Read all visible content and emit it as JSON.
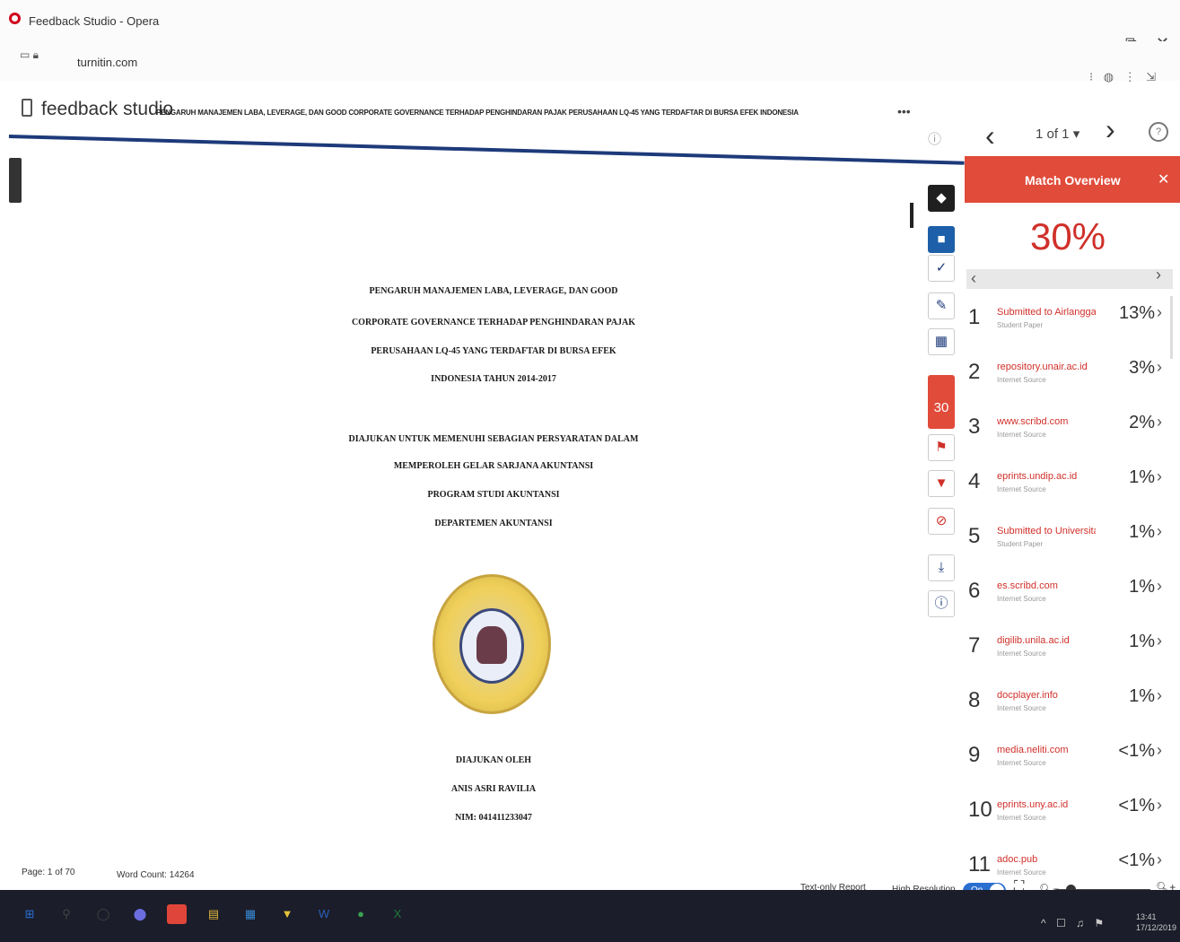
{
  "window": {
    "title": "Feedback Studio - Opera",
    "url": "turnitin.com",
    "minimize": "–",
    "restore": "⧉",
    "close": "✕",
    "toolbar_glyphs": "⁝ ◍ ⋮ ⇲"
  },
  "header": {
    "brand": "feedback studio",
    "document_title": "PENGARUH MANAJEMEN LABA, LEVERAGE, DAN GOOD CORPORATE GOVERNANCE TERHADAP PENGHINDARAN PAJAK PERUSAHAAN LQ-45 YANG TERDAFTAR DI BURSA EFEK INDONESIA",
    "more": "•••",
    "info": "ⓘ",
    "page_selector": "1 of 1 ▾",
    "prev": "‹",
    "next": "›",
    "help": "?"
  },
  "document": {
    "title_lines": [
      "PENGARUH MANAJEMEN LABA, LEVERAGE, DAN GOOD",
      "CORPORATE GOVERNANCE TERHADAP PENGHINDARAN PAJAK",
      "PERUSAHAAN LQ-45 YANG TERDAFTAR DI BURSA EFEK",
      "INDONESIA TAHUN 2014-2017"
    ],
    "purpose_lines": [
      "DIAJUKAN UNTUK MEMENUHI SEBAGIAN PERSYARATAN DALAM",
      "MEMPEROLEH GELAR SARJANA AKUNTANSI",
      "PROGRAM STUDI AKUNTANSI",
      "DEPARTEMEN AKUNTANSI"
    ],
    "author_lines": [
      "DIAJUKAN OLEH",
      "ANIS ASRI RAVILIA",
      "NIM: 041411233047"
    ]
  },
  "toolbar": {
    "layer_icon": "◆",
    "layer2_icon": "■",
    "check_icon": "✓",
    "edit_icon": "✎",
    "grid_icon": "▦",
    "score_badge": "30",
    "flag_icon": "⚑",
    "filter_icon": "▼",
    "exclude_icon": "⊘",
    "download_icon": "⤓",
    "info_icon": "ⓘ"
  },
  "match_overview": {
    "title": "Match Overview",
    "close": "✕",
    "score": "30%",
    "prev": "‹",
    "next": "›",
    "matches": [
      {
        "num": "1",
        "source": "Submitted to Airlangga",
        "type": "Student Paper",
        "pct": "13%"
      },
      {
        "num": "2",
        "source": "repository.unair.ac.id",
        "type": "Internet Source",
        "pct": "3%"
      },
      {
        "num": "3",
        "source": "www.scribd.com",
        "type": "Internet Source",
        "pct": "2%"
      },
      {
        "num": "4",
        "source": "eprints.undip.ac.id",
        "type": "Internet Source",
        "pct": "1%"
      },
      {
        "num": "5",
        "source": "Submitted to Universitas...",
        "type": "Student Paper",
        "pct": "1%"
      },
      {
        "num": "6",
        "source": "es.scribd.com",
        "type": "Internet Source",
        "pct": "1%"
      },
      {
        "num": "7",
        "source": "digilib.unila.ac.id",
        "type": "Internet Source",
        "pct": "1%"
      },
      {
        "num": "8",
        "source": "docplayer.info",
        "type": "Internet Source",
        "pct": "1%"
      },
      {
        "num": "9",
        "source": "media.neliti.com",
        "type": "Internet Source",
        "pct": "<1%"
      },
      {
        "num": "10",
        "source": "eprints.uny.ac.id",
        "type": "Internet Source",
        "pct": "<1%"
      },
      {
        "num": "11",
        "source": "adoc.pub",
        "type": "Internet Source",
        "pct": "<1%"
      }
    ],
    "arrow": "›"
  },
  "statusbar": {
    "page_info": "Page: 1 of 70",
    "word_count": "Word Count: 14264",
    "text_only": "Text-only Report",
    "high_resolution": "High Resolution",
    "toggle_state": "On",
    "expand": "⛶",
    "zoom_out": "🔍︎−",
    "zoom_in": "🔍︎+",
    "zoom_level": 0.16
  },
  "taskbar": {
    "icons": [
      "⊞",
      "⚲",
      "◯",
      "⬤",
      "O",
      "▤",
      "▦",
      "▼",
      "W",
      "●",
      "X"
    ],
    "tray": "^ ☐ ♫ ⚑",
    "time": "13:41",
    "date": "17/12/2019"
  },
  "colors": {
    "accent_red": "#e04b3a",
    "navy": "#1d3a7a",
    "toggle_blue": "#2a6fcf"
  }
}
